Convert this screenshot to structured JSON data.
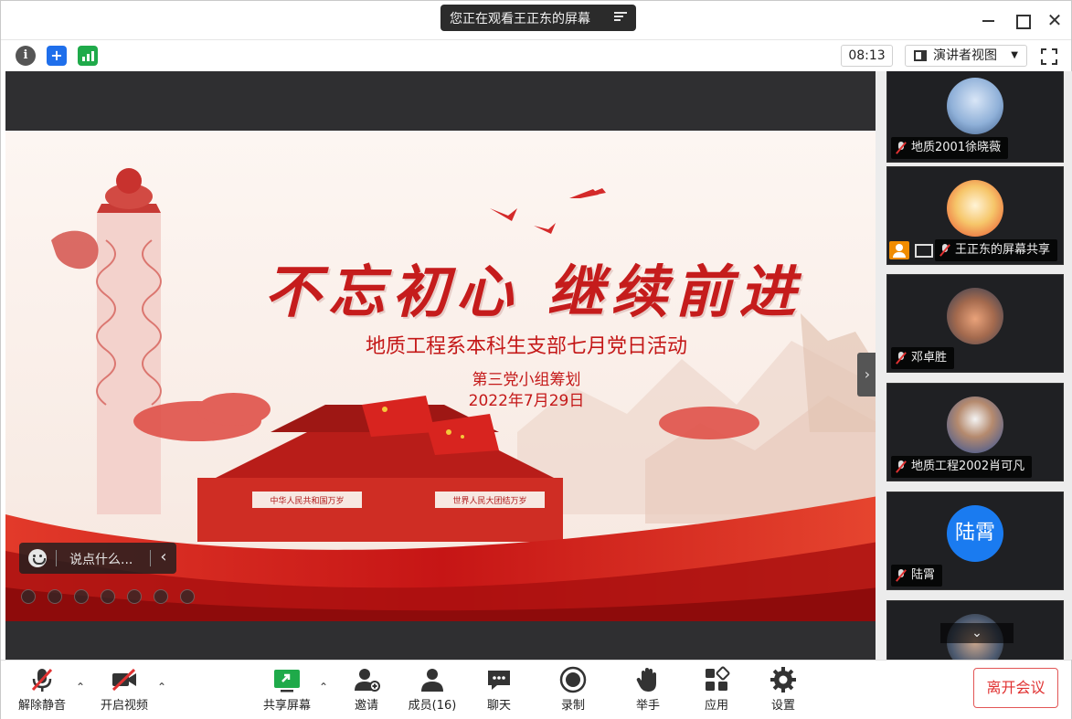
{
  "window": {
    "share_status": "您正在观看王正东的屏幕"
  },
  "infobar": {
    "timer": "08:13",
    "view_mode": "演讲者视图"
  },
  "slide": {
    "title_art": "不忘初心 继续前进",
    "subtitle": "地质工程系本科生支部七月党日活动",
    "organizer": "第三党小组筹划",
    "date": "2022年7月29日",
    "gate_plaque_left": "中华人民共和国万岁",
    "gate_plaque_right": "世界人民大团结万岁"
  },
  "chat": {
    "placeholder": "说点什么..."
  },
  "participants": [
    {
      "name": "地质2001徐晓薇",
      "avatar": "photo",
      "muted": true
    },
    {
      "name": "王正东的屏幕共享",
      "avatar": "cartoon",
      "muted": true,
      "host": true,
      "sharing": true
    },
    {
      "name": "邓卓胜",
      "avatar": "photo",
      "muted": true
    },
    {
      "name": "地质工程2002肖可凡",
      "avatar": "photo",
      "muted": true
    },
    {
      "name": "陆霄",
      "avatar_text": "陆霄",
      "muted": true
    },
    {
      "name": "",
      "avatar": "photo"
    }
  ],
  "toolbar": {
    "unmute": "解除静音",
    "start_video": "开启视频",
    "share_screen": "共享屏幕",
    "invite": "邀请",
    "members": "成员(16)",
    "chat": "聊天",
    "record": "录制",
    "raise_hand": "举手",
    "apps": "应用",
    "settings": "设置",
    "leave": "离开会议"
  },
  "colors": {
    "accent_red": "#c41818",
    "leave_red": "#e03131",
    "share_green": "#1faa4a",
    "avatar_blue": "#1a7bf0"
  }
}
